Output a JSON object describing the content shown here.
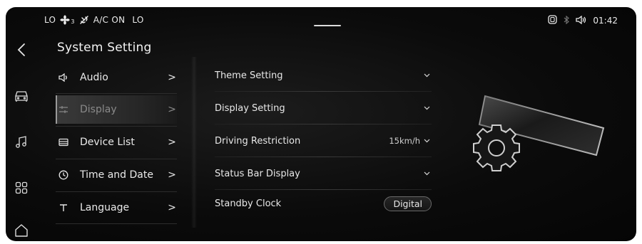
{
  "status_bar": {
    "left_temp": "LO",
    "fan_level": "3",
    "ac_label": "A/C ON",
    "right_temp": "LO",
    "icons": [
      "fan-icon",
      "airflow-icon",
      "phone-projection-icon",
      "bluetooth-icon",
      "volume-icon"
    ],
    "clock": "01:42"
  },
  "rail": {
    "items": [
      "back-icon",
      "car-icon",
      "music-icon",
      "apps-icon",
      "home-icon"
    ]
  },
  "page_title": "System Setting",
  "menu": {
    "items": [
      {
        "label": "Audio",
        "icon": "speaker-icon",
        "chevron": ">"
      },
      {
        "label": "Display",
        "icon": "sliders-icon",
        "chevron": ">",
        "active": true
      },
      {
        "label": "Device List",
        "icon": "device-list-icon",
        "chevron": ">"
      },
      {
        "label": "Time and Date",
        "icon": "clock-icon",
        "chevron": ">"
      },
      {
        "label": "Language",
        "icon": "text-icon",
        "chevron": ">"
      }
    ]
  },
  "settings": {
    "rows": [
      {
        "label": "Theme Setting",
        "value": "",
        "control": "chevron-down"
      },
      {
        "label": "Display Setting",
        "value": "",
        "control": "chevron-down"
      },
      {
        "label": "Driving Restriction",
        "value": "15km/h",
        "control": "chevron-down"
      },
      {
        "label": "Status Bar Display",
        "value": "",
        "control": "chevron-down"
      },
      {
        "label": "Standby Clock",
        "value": "Digital",
        "control": "pill"
      }
    ]
  },
  "colors": {
    "background": "#0b0b0b",
    "text": "#e9e9e9",
    "active_item_text": "#8a8a8a",
    "divider": "#2c2c2c"
  }
}
